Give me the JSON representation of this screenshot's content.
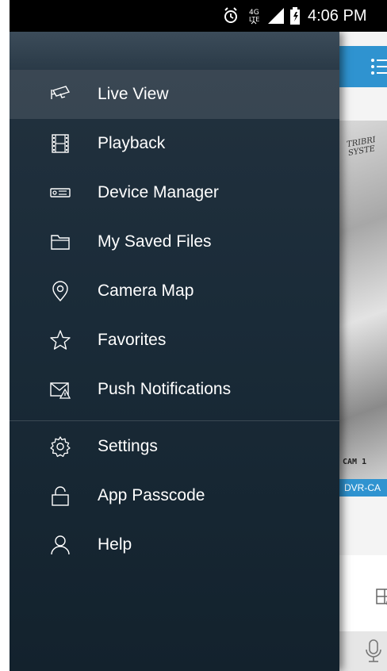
{
  "status_bar": {
    "time": "4:06 PM",
    "icons": [
      "alarm-clock-icon",
      "4g-lte-icon",
      "signal-icon",
      "battery-icon"
    ]
  },
  "drawer": {
    "menu_items": [
      {
        "label": "Live View",
        "icon": "cctv-camera-icon",
        "active": true
      },
      {
        "label": "Playback",
        "icon": "film-strip-icon"
      },
      {
        "label": "Device Manager",
        "icon": "dvr-device-icon"
      },
      {
        "label": "My Saved Files",
        "icon": "folder-icon"
      },
      {
        "label": "Camera Map",
        "icon": "map-pin-icon"
      },
      {
        "label": "Favorites",
        "icon": "star-icon"
      },
      {
        "label": "Push Notifications",
        "icon": "envelope-alert-icon"
      },
      {
        "label": "Settings",
        "icon": "gear-icon"
      },
      {
        "label": "App Passcode",
        "icon": "padlock-icon"
      },
      {
        "label": "Help",
        "icon": "person-icon"
      }
    ]
  },
  "background_app": {
    "camera_brand_text": "TRIBRI\nSYSTE",
    "camera_osd_text": "CAM 1",
    "camera_label": "DVR-CA",
    "grid_badge": "4"
  },
  "colors": {
    "toolbar_blue": "#2f93d0",
    "drawer_bg": "#1a2b38",
    "status_bar": "#000000"
  }
}
